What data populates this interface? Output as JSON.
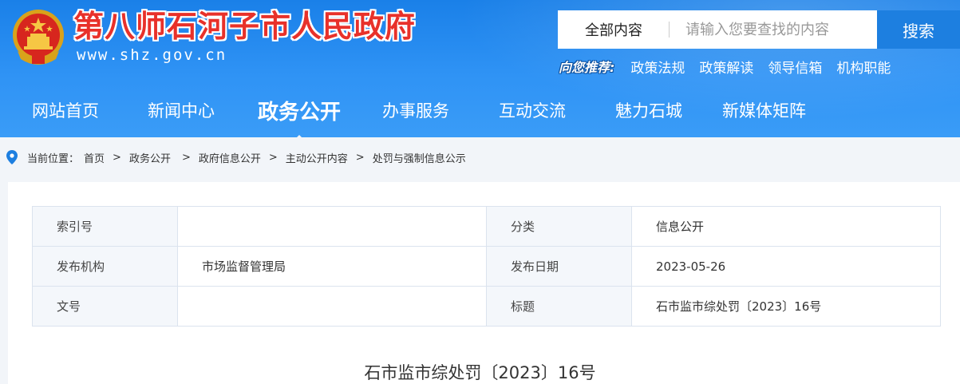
{
  "header": {
    "site_title": "第八师石河子市人民政府",
    "site_url": "www.shz.gov.cn",
    "search": {
      "scope": "全部内容",
      "placeholder": "请输入您要查找的内容",
      "button": "搜索"
    },
    "recommend": {
      "tag": "向您推荐:",
      "links": [
        "政策法规",
        "政策解读",
        "领导信箱",
        "机构职能"
      ]
    },
    "nav": [
      {
        "label": "网站首页"
      },
      {
        "label": "新闻中心"
      },
      {
        "label": "政务公开",
        "active": true
      },
      {
        "label": "办事服务"
      },
      {
        "label": "互动交流"
      },
      {
        "label": "魅力石城"
      },
      {
        "label": "新媒体矩阵"
      }
    ]
  },
  "breadcrumb": {
    "label": "当前位置：",
    "items": [
      "首页",
      "政务公开",
      "政府信息公开",
      "主动公开内容",
      "处罚与强制信息公示"
    ]
  },
  "meta_table": {
    "rows": [
      {
        "k1": "索引号",
        "v1": "",
        "k2": "分类",
        "v2": "信息公开"
      },
      {
        "k1": "发布机构",
        "v1": "市场监督管理局",
        "k2": "发布日期",
        "v2": "2023-05-26"
      },
      {
        "k1": "文号",
        "v1": "",
        "k2": "标题",
        "v2": "石市监市综处罚〔2023〕16号"
      }
    ]
  },
  "document": {
    "title": "石市监市综处罚〔2023〕16号"
  },
  "colors": {
    "header_blue": "#2f93f5",
    "search_button": "#1d7fe0",
    "title_red": "#e8312a"
  },
  "icons": {
    "emblem": "national-emblem-icon",
    "location": "location-pin-icon"
  }
}
